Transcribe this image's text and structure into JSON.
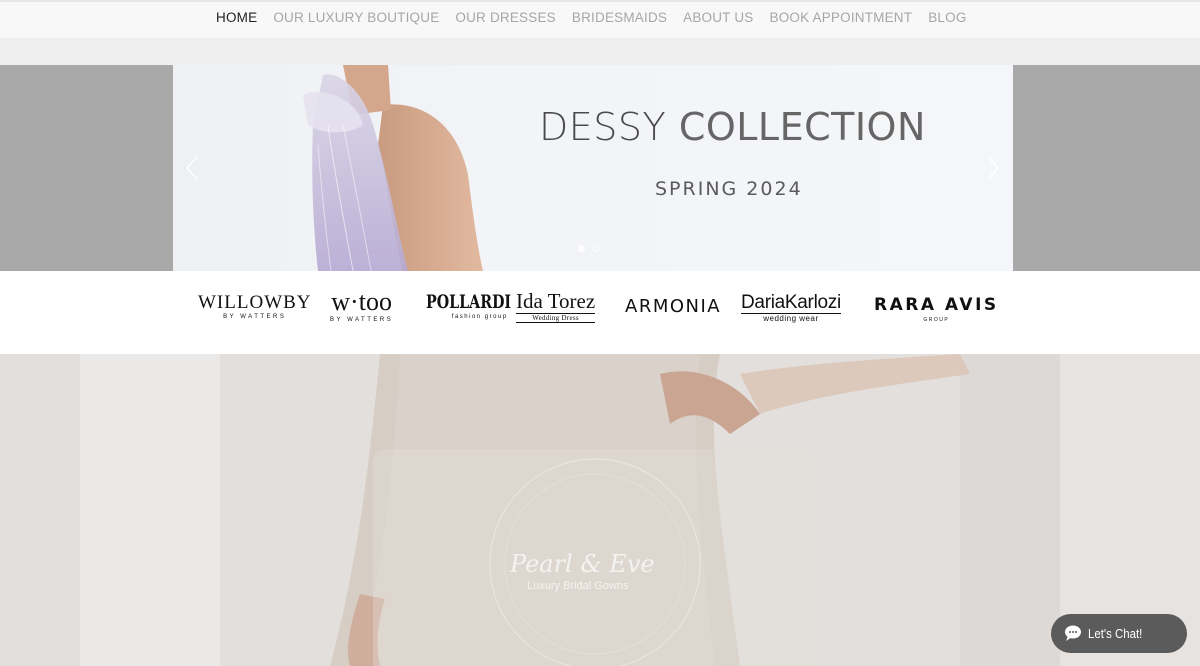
{
  "nav": {
    "items": [
      {
        "label": "HOME",
        "active": true
      },
      {
        "label": "OUR LUXURY BOUTIQUE",
        "active": false
      },
      {
        "label": "OUR DRESSES",
        "active": false
      },
      {
        "label": "BRIDESMAIDS",
        "active": false
      },
      {
        "label": "ABOUT US",
        "active": false
      },
      {
        "label": "BOOK APPOINTMENT",
        "active": false
      },
      {
        "label": "BLOG",
        "active": false
      }
    ]
  },
  "hero": {
    "title_bold": "DESSY",
    "title_light": " COLLECTION",
    "subtitle": "SPRING 2024",
    "prev_icon": "chevron-left-icon",
    "next_icon": "chevron-right-icon",
    "slides_total": 2,
    "slide_active": 1
  },
  "brands": {
    "willowby": {
      "name": "WILLOWBY",
      "sub": "BY WATTERS"
    },
    "wtoo": {
      "name": "w·too",
      "sub": "BY WATTERS"
    },
    "pollardi": {
      "name": "POLLARDI",
      "sub": "fashion group"
    },
    "ida": {
      "name": "Ida Torez",
      "sub": "Wedding Dress"
    },
    "armonia": {
      "name": "ARMONIA"
    },
    "daria": {
      "name": "DariaKarlozi",
      "sub": "wedding wear"
    },
    "rara": {
      "name": "RARA AVIS",
      "sub": "GROUP"
    }
  },
  "feature": {
    "watermark_title": "Pearl & Eve",
    "watermark_sub": "Luxury Bridal Gowns"
  },
  "chat": {
    "label": "Let's Chat!",
    "icon": "chat-bubble-icon"
  },
  "colors": {
    "nav_active": "#222222",
    "nav_inactive": "#a6a6a6",
    "hero_side": "#a9a9a9",
    "chat_bg": "#5b5b5b"
  }
}
